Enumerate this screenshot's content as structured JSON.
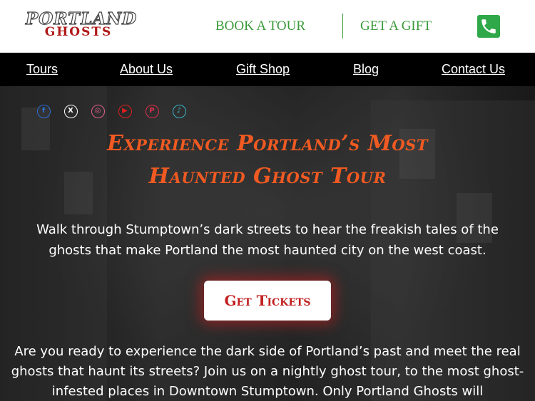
{
  "header": {
    "logo_line1": "PORTLAND",
    "logo_line2": "GHOSTS",
    "book_tour": "BOOK A TOUR",
    "get_gift": "GET A GIFT",
    "accent_color": "#3a9a3a"
  },
  "nav": {
    "items": [
      "Tours",
      "About Us",
      "Gift Shop",
      "Blog",
      "Contact Us"
    ]
  },
  "socials": [
    {
      "icon": "facebook-icon",
      "glyph": "f",
      "color": "#2b6fd6"
    },
    {
      "icon": "x-icon",
      "glyph": "X",
      "color": "#ffffff"
    },
    {
      "icon": "instagram-icon",
      "glyph": "◎",
      "color": "#e0608a"
    },
    {
      "icon": "youtube-icon",
      "glyph": "▶",
      "color": "#e02020"
    },
    {
      "icon": "pinterest-icon",
      "glyph": "P",
      "color": "#e0304a"
    },
    {
      "icon": "tiktok-icon",
      "glyph": "♪",
      "color": "#3ab4c8"
    }
  ],
  "hero": {
    "headline_line1": "Experience Portland’s Most",
    "headline_line2": "Haunted Ghost Tour",
    "intro": "Walk through Stumptown’s dark streets to hear the freakish tales of the ghosts that make Portland the most haunted city on the west coast.",
    "cta": "Get Tickets",
    "body": "Are you ready to experience the dark side of Portland’s past and meet the real ghosts that haunt its streets? Join us on a nightly ghost tour, to the most ghost-infested places in Downtown Stumptown. Only Portland Ghosts will",
    "headline_color": "#f05a22",
    "cta_color": "#c21f1f"
  }
}
